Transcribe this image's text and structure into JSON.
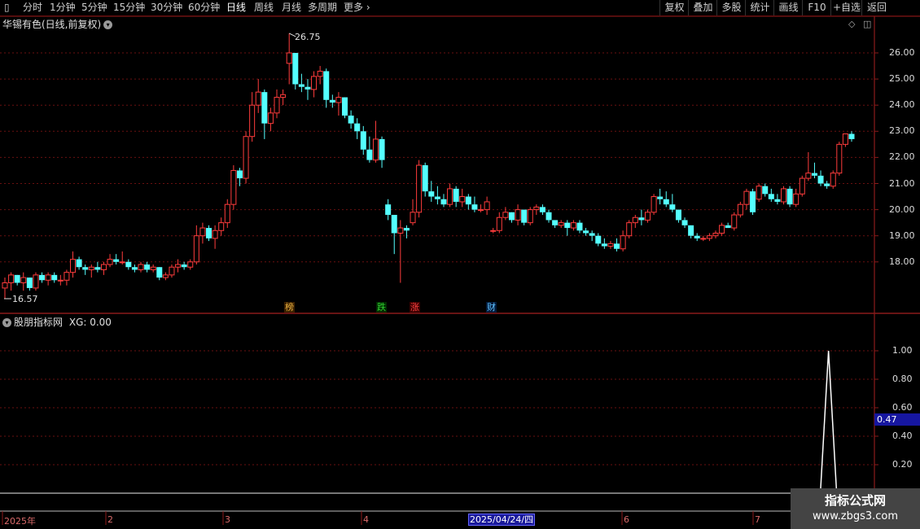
{
  "toolbar": {
    "periods": [
      "分时",
      "1分钟",
      "5分钟",
      "15分钟",
      "30分钟",
      "60分钟",
      "日线",
      "周线",
      "月线",
      "多周期",
      "更多"
    ],
    "active": "日线",
    "right": [
      "复权",
      "叠加",
      "多股",
      "统计",
      "画线",
      "F10",
      "+自选",
      "返回"
    ]
  },
  "chart": {
    "title": "华锡有色(日线,前复权)",
    "high_label": "26.75",
    "low_label": "16.57",
    "y_ticks": [
      "26.00",
      "25.00",
      "24.00",
      "23.00",
      "22.00",
      "21.00",
      "20.00",
      "19.00",
      "18.00"
    ],
    "events": [
      {
        "text": "榜",
        "color": "#e8b040",
        "bg": "#3a2000"
      },
      {
        "text": "跌",
        "color": "#30d030",
        "bg": "#002a00"
      },
      {
        "text": "涨",
        "color": "#ff4040",
        "bg": "#3a0000"
      },
      {
        "text": "财",
        "color": "#60c0ff",
        "bg": "#001a3a"
      }
    ],
    "up_color": "#ff3c3c",
    "down_color": "#54ffff"
  },
  "indicator": {
    "title": "股朋指标网",
    "xg_label": "XG: 0.00",
    "y_ticks": [
      "1.00",
      "0.80",
      "0.60",
      "0.40",
      "0.20"
    ],
    "current_value": "0.47"
  },
  "x_axis": {
    "labels": [
      "2025年",
      "2",
      "3",
      "4",
      "6",
      "7"
    ],
    "selected_date": "2025/04/24/四"
  },
  "watermark": {
    "line1": "指标公式网",
    "line2": "www.zbgs3.com"
  },
  "chart_data": {
    "type": "candlestick",
    "title": "华锡有色(日线,前复权)",
    "ylim": [
      16.5,
      26.9
    ],
    "candles": [
      [
        17.0,
        17.4,
        16.6,
        17.2
      ],
      [
        17.2,
        17.6,
        16.9,
        17.5
      ],
      [
        17.5,
        17.5,
        17.1,
        17.2
      ],
      [
        17.2,
        17.6,
        16.9,
        17.4
      ],
      [
        17.4,
        17.4,
        16.9,
        17.0
      ],
      [
        17.0,
        17.6,
        16.9,
        17.5
      ],
      [
        17.5,
        17.6,
        17.2,
        17.3
      ],
      [
        17.3,
        17.6,
        17.1,
        17.5
      ],
      [
        17.5,
        17.6,
        17.2,
        17.3
      ],
      [
        17.3,
        17.5,
        17.1,
        17.3
      ],
      [
        17.3,
        17.7,
        17.1,
        17.6
      ],
      [
        17.6,
        18.4,
        17.4,
        18.1
      ],
      [
        18.1,
        18.2,
        17.7,
        17.8
      ],
      [
        17.8,
        17.9,
        17.5,
        17.7
      ],
      [
        17.7,
        17.9,
        17.4,
        17.8
      ],
      [
        17.8,
        18.0,
        17.6,
        17.7
      ],
      [
        17.7,
        18.0,
        17.5,
        17.9
      ],
      [
        17.9,
        18.3,
        17.8,
        18.1
      ],
      [
        18.1,
        18.3,
        17.9,
        18.0
      ],
      [
        18.0,
        18.4,
        17.9,
        18.0
      ],
      [
        18.0,
        18.1,
        17.7,
        17.8
      ],
      [
        17.8,
        17.9,
        17.6,
        17.7
      ],
      [
        17.7,
        18.0,
        17.6,
        17.9
      ],
      [
        17.9,
        18.0,
        17.6,
        17.7
      ],
      [
        17.7,
        17.9,
        17.6,
        17.8
      ],
      [
        17.8,
        17.8,
        17.3,
        17.4
      ],
      [
        17.4,
        17.6,
        17.3,
        17.5
      ],
      [
        17.5,
        17.9,
        17.4,
        17.8
      ],
      [
        17.8,
        18.1,
        17.6,
        17.9
      ],
      [
        17.9,
        18.0,
        17.7,
        17.8
      ],
      [
        17.8,
        18.1,
        17.7,
        18.0
      ],
      [
        18.0,
        19.4,
        17.9,
        19.0
      ],
      [
        19.0,
        19.5,
        18.7,
        19.3
      ],
      [
        19.3,
        19.4,
        18.8,
        18.9
      ],
      [
        18.9,
        19.4,
        18.5,
        19.2
      ],
      [
        19.2,
        19.7,
        19.0,
        19.5
      ],
      [
        19.5,
        20.4,
        19.3,
        20.2
      ],
      [
        20.2,
        21.7,
        20.0,
        21.5
      ],
      [
        21.5,
        21.6,
        20.9,
        21.2
      ],
      [
        21.2,
        23.0,
        21.0,
        22.8
      ],
      [
        22.8,
        24.5,
        22.6,
        24.0
      ],
      [
        24.0,
        25.0,
        23.7,
        24.5
      ],
      [
        24.5,
        24.6,
        22.7,
        23.3
      ],
      [
        23.3,
        23.9,
        23.0,
        23.7
      ],
      [
        23.7,
        24.6,
        23.5,
        24.3
      ],
      [
        24.3,
        24.6,
        24.0,
        24.4
      ],
      [
        25.6,
        26.75,
        24.8,
        26.0
      ],
      [
        26.0,
        26.0,
        24.6,
        24.8
      ],
      [
        24.8,
        25.2,
        24.5,
        24.7
      ],
      [
        24.7,
        25.0,
        24.2,
        24.6
      ],
      [
        24.6,
        25.3,
        24.3,
        25.1
      ],
      [
        25.1,
        25.5,
        24.8,
        25.3
      ],
      [
        25.3,
        25.4,
        23.9,
        24.2
      ],
      [
        24.2,
        24.4,
        23.9,
        24.1
      ],
      [
        24.1,
        24.5,
        23.6,
        24.3
      ],
      [
        24.3,
        24.3,
        23.5,
        23.6
      ],
      [
        23.6,
        23.8,
        23.1,
        23.3
      ],
      [
        23.3,
        23.5,
        22.7,
        23.0
      ],
      [
        23.0,
        23.2,
        22.1,
        22.3
      ],
      [
        22.3,
        22.8,
        21.8,
        21.9
      ],
      [
        21.9,
        23.4,
        21.8,
        22.7
      ],
      [
        22.7,
        22.8,
        21.6,
        21.9
      ],
      [
        20.2,
        20.4,
        19.6,
        19.8
      ],
      [
        19.8,
        19.8,
        18.3,
        19.1
      ],
      [
        19.1,
        19.6,
        17.2,
        19.3
      ],
      [
        19.3,
        19.4,
        18.9,
        19.2
      ],
      [
        19.5,
        20.4,
        19.4,
        19.9
      ],
      [
        19.9,
        21.9,
        19.7,
        21.7
      ],
      [
        21.7,
        21.8,
        20.5,
        20.7
      ],
      [
        20.7,
        21.1,
        20.3,
        20.5
      ],
      [
        20.5,
        20.9,
        20.2,
        20.4
      ],
      [
        20.4,
        20.6,
        20.1,
        20.2
      ],
      [
        20.2,
        21.0,
        20.1,
        20.8
      ],
      [
        20.8,
        20.9,
        20.1,
        20.3
      ],
      [
        20.3,
        20.8,
        20.1,
        20.5
      ],
      [
        20.5,
        20.6,
        20.0,
        20.2
      ],
      [
        20.2,
        20.5,
        19.9,
        20.0
      ],
      [
        20.0,
        20.2,
        19.9,
        20.0
      ],
      [
        20.0,
        20.5,
        19.8,
        20.3
      ],
      [
        19.2,
        19.3,
        19.1,
        19.2
      ],
      [
        19.2,
        19.9,
        19.1,
        19.7
      ],
      [
        19.7,
        20.1,
        19.6,
        19.9
      ],
      [
        19.9,
        19.9,
        19.5,
        19.6
      ],
      [
        19.6,
        20.2,
        19.4,
        20.0
      ],
      [
        20.0,
        20.0,
        19.4,
        19.5
      ],
      [
        19.5,
        20.1,
        19.4,
        20.0
      ],
      [
        20.0,
        20.2,
        19.8,
        20.1
      ],
      [
        20.1,
        20.2,
        19.8,
        19.9
      ],
      [
        19.9,
        20.0,
        19.5,
        19.6
      ],
      [
        19.6,
        19.6,
        19.3,
        19.4
      ],
      [
        19.4,
        19.6,
        19.3,
        19.5
      ],
      [
        19.5,
        19.6,
        19.0,
        19.3
      ],
      [
        19.3,
        19.6,
        19.2,
        19.5
      ],
      [
        19.5,
        19.6,
        19.1,
        19.2
      ],
      [
        19.2,
        19.3,
        19.0,
        19.1
      ],
      [
        19.1,
        19.2,
        18.8,
        19.0
      ],
      [
        19.0,
        19.1,
        18.6,
        18.7
      ],
      [
        18.7,
        18.9,
        18.5,
        18.6
      ],
      [
        18.6,
        18.8,
        18.5,
        18.7
      ],
      [
        18.7,
        18.9,
        18.4,
        18.5
      ],
      [
        18.5,
        19.2,
        18.4,
        19.0
      ],
      [
        19.0,
        19.6,
        18.9,
        19.5
      ],
      [
        19.5,
        19.8,
        19.3,
        19.7
      ],
      [
        19.7,
        20.0,
        19.4,
        19.6
      ],
      [
        19.6,
        20.0,
        19.5,
        19.9
      ],
      [
        19.9,
        20.6,
        19.8,
        20.5
      ],
      [
        20.5,
        20.8,
        20.2,
        20.4
      ],
      [
        20.4,
        20.7,
        20.1,
        20.2
      ],
      [
        20.2,
        20.6,
        19.9,
        20.0
      ],
      [
        20.0,
        20.0,
        19.5,
        19.6
      ],
      [
        19.6,
        19.7,
        19.3,
        19.4
      ],
      [
        19.4,
        19.4,
        18.9,
        19.0
      ],
      [
        19.0,
        19.1,
        18.8,
        18.9
      ],
      [
        18.9,
        19.0,
        18.8,
        18.9
      ],
      [
        18.9,
        19.1,
        18.8,
        19.0
      ],
      [
        19.0,
        19.2,
        18.9,
        19.1
      ],
      [
        19.1,
        19.5,
        19.0,
        19.4
      ],
      [
        19.4,
        19.5,
        19.3,
        19.3
      ],
      [
        19.3,
        19.9,
        19.2,
        19.8
      ],
      [
        19.8,
        20.3,
        19.7,
        20.2
      ],
      [
        20.2,
        20.8,
        20.0,
        20.7
      ],
      [
        20.7,
        20.8,
        19.8,
        19.9
      ],
      [
        20.4,
        21.0,
        20.3,
        20.9
      ],
      [
        20.9,
        21.0,
        20.5,
        20.6
      ],
      [
        20.6,
        20.8,
        20.3,
        20.4
      ],
      [
        20.4,
        20.6,
        20.2,
        20.3
      ],
      [
        20.3,
        20.9,
        20.2,
        20.8
      ],
      [
        20.8,
        20.9,
        20.1,
        20.2
      ],
      [
        20.2,
        20.8,
        20.1,
        20.6
      ],
      [
        20.6,
        21.3,
        20.5,
        21.2
      ],
      [
        21.2,
        22.2,
        21.1,
        21.4
      ],
      [
        21.4,
        21.8,
        21.2,
        21.3
      ],
      [
        21.3,
        21.5,
        20.9,
        21.0
      ],
      [
        21.0,
        21.1,
        20.8,
        20.9
      ],
      [
        20.9,
        21.5,
        20.8,
        21.4
      ],
      [
        21.4,
        22.6,
        21.3,
        22.5
      ],
      [
        22.5,
        22.9,
        22.4,
        22.9
      ],
      [
        22.9,
        23.0,
        22.6,
        22.7
      ]
    ],
    "indicator": {
      "name": "XG",
      "values_note": "spike to 1.00 at bar 133"
    }
  }
}
